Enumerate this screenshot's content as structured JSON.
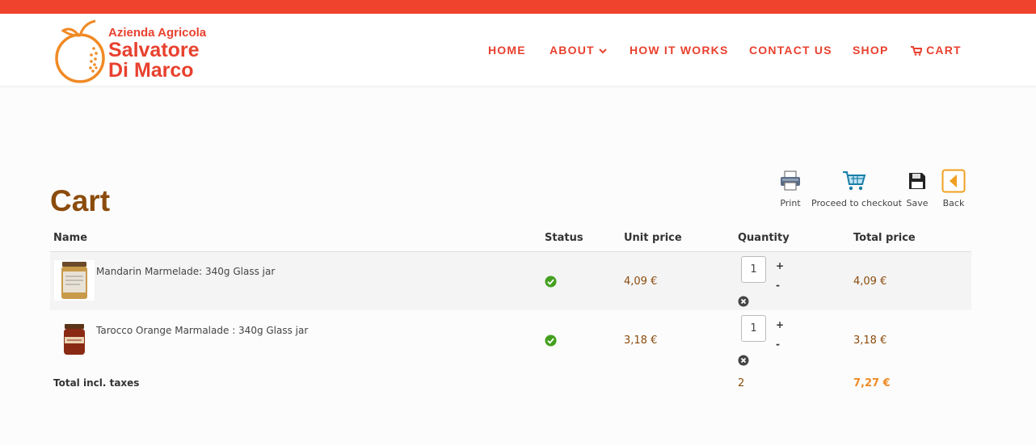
{
  "brand": {
    "line1": "Azienda Agricola",
    "line2": "Salvatore",
    "line3": "Di Marco",
    "color": "#e8412f",
    "logo_icon": "orange-fruit-icon"
  },
  "nav": {
    "items": [
      {
        "label": "HOME"
      },
      {
        "label": "ABOUT"
      },
      {
        "label": "HOW IT WORKS"
      },
      {
        "label": "CONTACT US"
      },
      {
        "label": "SHOP"
      },
      {
        "label": "CART",
        "icon": "cart-icon"
      }
    ]
  },
  "page": {
    "title": "Cart"
  },
  "toolbar": {
    "print": "Print",
    "checkout": "Proceed to checkout",
    "save": "Save",
    "back": "Back"
  },
  "table": {
    "headers": {
      "name": "Name",
      "status": "Status",
      "unit_price": "Unit price",
      "quantity": "Quantity",
      "total_price": "Total price"
    },
    "rows": [
      {
        "name": "Mandarin Marmelade: 340g Glass jar",
        "status": "available",
        "unit_price": "4,09 €",
        "quantity": "1",
        "total_price": "4,09 €",
        "plus": "+",
        "minus": "-"
      },
      {
        "name": "Tarocco Orange Marmalade : 340g Glass jar",
        "status": "available",
        "unit_price": "3,18 €",
        "quantity": "1",
        "total_price": "3,18 €",
        "plus": "+",
        "minus": "-"
      }
    ],
    "footer": {
      "label": "Total incl. taxes",
      "quantity": "2",
      "total": "7,27 €"
    }
  },
  "colors": {
    "accent": "#e8412f",
    "title": "#8b4b0c",
    "status_ok": "#43a01f",
    "total": "#f08a25"
  }
}
